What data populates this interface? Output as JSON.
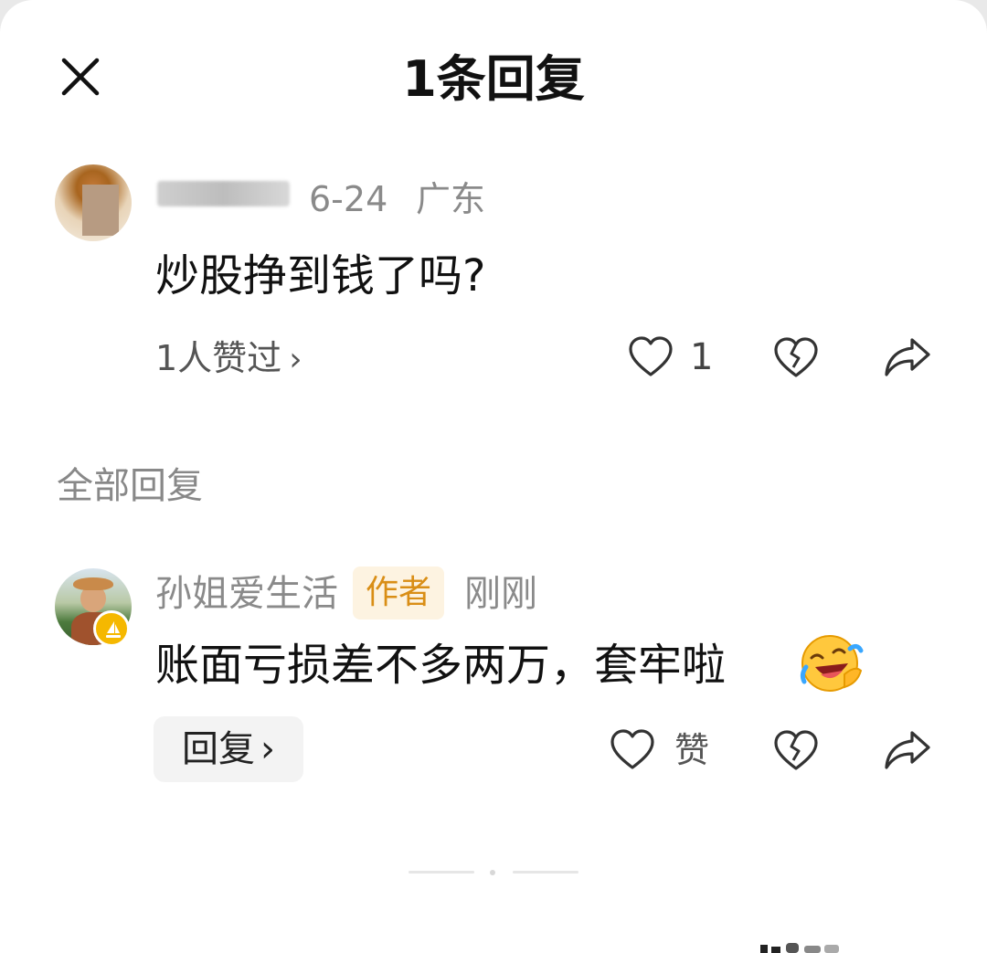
{
  "header": {
    "title": "1条回复",
    "close_icon": "close-icon"
  },
  "parent_comment": {
    "date": "6-24",
    "location": "广东",
    "text": "炒股挣到钱了吗?",
    "likers_text": "1人赞过",
    "likers_chevron": "›",
    "like_count": "1"
  },
  "replies_section": {
    "label": "全部回复"
  },
  "reply": {
    "author": "孙姐爱生活",
    "author_tag": "作者",
    "time": "刚刚",
    "text": "账面亏损差不多两万，套牢啦",
    "emoji": "rofl-emoji",
    "reply_button": "回复",
    "reply_chevron": "›",
    "like_label": "赞"
  },
  "colors": {
    "accent_badge": "#f5b800",
    "author_tag_text": "#d98e16",
    "author_tag_bg": "#fdf3e1",
    "meta_text": "#8a8a8a"
  }
}
